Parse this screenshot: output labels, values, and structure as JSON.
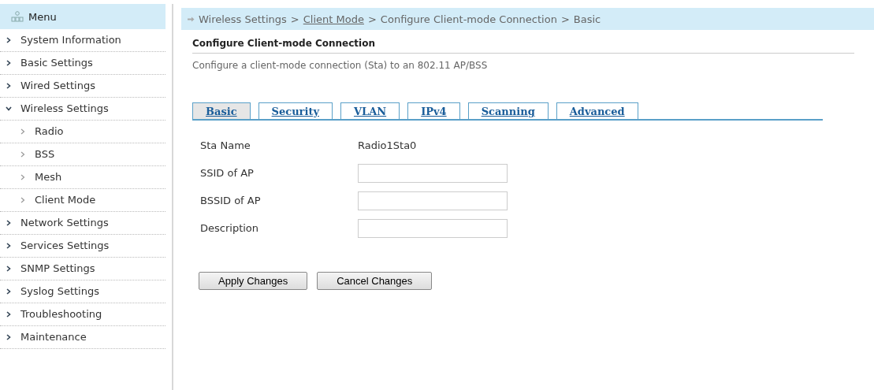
{
  "menu": {
    "title": "Menu",
    "items": [
      {
        "label": "System Information",
        "expanded": false
      },
      {
        "label": "Basic Settings",
        "expanded": false
      },
      {
        "label": "Wired Settings",
        "expanded": false
      },
      {
        "label": "Wireless Settings",
        "expanded": true,
        "children": [
          {
            "label": "Radio"
          },
          {
            "label": "BSS"
          },
          {
            "label": "Mesh"
          },
          {
            "label": "Client Mode"
          }
        ]
      },
      {
        "label": "Network Settings",
        "expanded": false
      },
      {
        "label": "Services Settings",
        "expanded": false
      },
      {
        "label": "SNMP Settings",
        "expanded": false
      },
      {
        "label": "Syslog Settings",
        "expanded": false
      },
      {
        "label": "Troubleshooting",
        "expanded": false
      },
      {
        "label": "Maintenance",
        "expanded": false
      }
    ]
  },
  "breadcrumb": [
    {
      "label": "Wireless Settings",
      "kind": "text"
    },
    {
      "label": ">",
      "kind": "text"
    },
    {
      "label": "Client Mode",
      "kind": "link"
    },
    {
      "label": ">",
      "kind": "text"
    },
    {
      "label": "Configure Client-mode Connection",
      "kind": "text"
    },
    {
      "label": ">",
      "kind": "text"
    },
    {
      "label": "Basic",
      "kind": "text"
    }
  ],
  "page": {
    "title": "Configure Client-mode Connection",
    "description": "Configure a client-mode connection (Sta) to an 802.11 AP/BSS"
  },
  "tabs": [
    {
      "label": "Basic",
      "selected": true
    },
    {
      "label": "Security",
      "selected": false
    },
    {
      "label": "VLAN",
      "selected": false
    },
    {
      "label": "IPv4",
      "selected": false
    },
    {
      "label": "Scanning",
      "selected": false
    },
    {
      "label": "Advanced",
      "selected": false
    }
  ],
  "fields": [
    {
      "label": "Sta Name",
      "kind": "text",
      "value": "Radio1Sta0"
    },
    {
      "label": "SSID of AP",
      "kind": "input"
    },
    {
      "label": "BSSID of AP",
      "kind": "input"
    },
    {
      "label": "Description",
      "kind": "input"
    }
  ],
  "buttons": [
    "Apply Changes",
    "Cancel Changes"
  ]
}
